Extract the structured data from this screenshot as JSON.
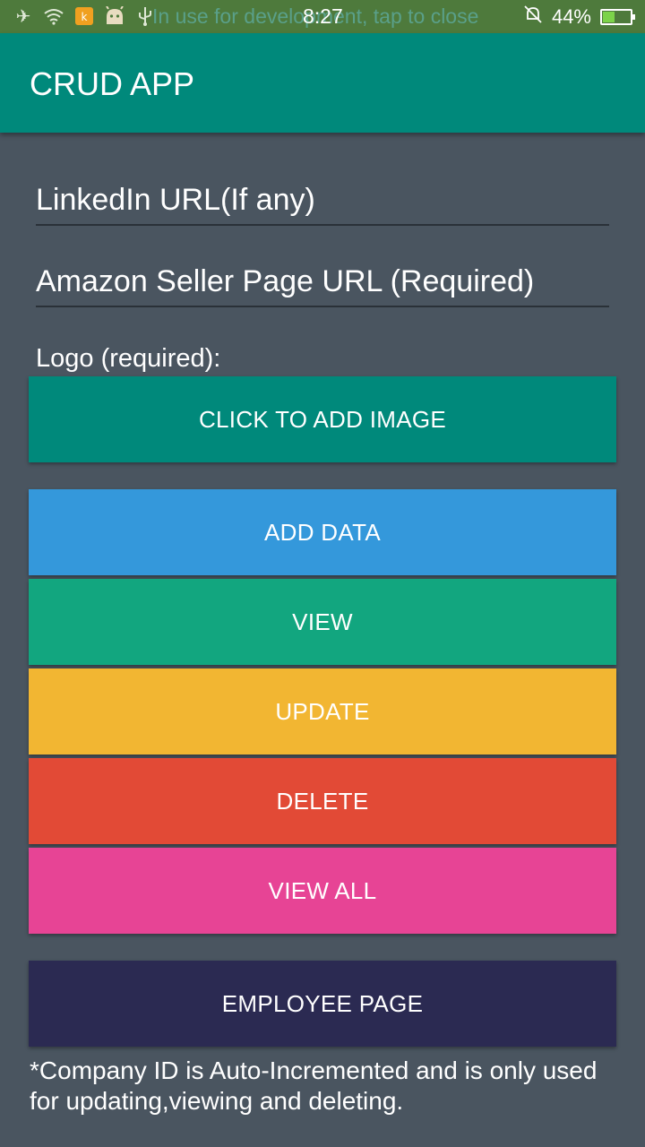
{
  "status_bar": {
    "notification_text": "In use for development, tap to close",
    "time": "8:27",
    "battery_percent": "44%",
    "battery_level": 0.44,
    "icons": [
      "airplane-icon",
      "wifi-icon",
      "notification-app-icon",
      "android-icon",
      "usb-icon",
      "silent-icon",
      "battery-icon"
    ]
  },
  "app_bar": {
    "title": "CRUD APP"
  },
  "form": {
    "linkedin_placeholder": "LinkedIn URL(If any)",
    "amazon_placeholder": "Amazon Seller Page URL (Required)",
    "logo_label": "Logo (required):"
  },
  "buttons": {
    "add_image": "CLICK TO ADD IMAGE",
    "add_data": "ADD DATA",
    "view": "VIEW",
    "update": "UPDATE",
    "delete": "DELETE",
    "view_all": "VIEW ALL",
    "employee_page": "EMPLOYEE PAGE"
  },
  "note": "*Company ID is Auto-Incremented and is only used for updating,viewing and deleting.",
  "colors": {
    "background": "#4a5560",
    "app_bar": "#00897b",
    "add_data": "#3498db",
    "view": "#12a67f",
    "update": "#f2b632",
    "delete": "#e24a36",
    "view_all": "#e74495",
    "employee_page": "#2b2a52"
  }
}
